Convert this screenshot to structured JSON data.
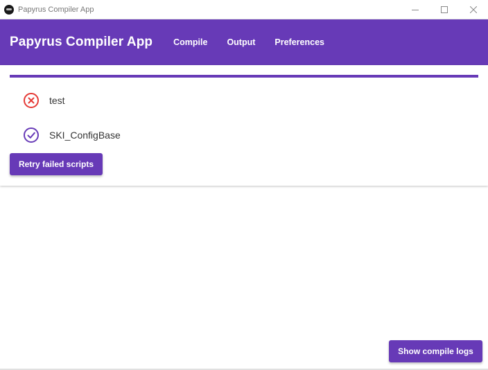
{
  "window": {
    "title": "Papyrus Compiler App",
    "controls": [
      "minimize-icon",
      "maximize-icon",
      "close-icon"
    ]
  },
  "appbar": {
    "title": "Papyrus Compiler App",
    "nav": [
      {
        "label": "Compile"
      },
      {
        "label": "Output"
      },
      {
        "label": "Preferences"
      }
    ]
  },
  "progress": {
    "value": 1.0
  },
  "scripts": [
    {
      "name": "test",
      "status": "failed",
      "icon": "error-circle-icon"
    },
    {
      "name": "SKI_ConfigBase",
      "status": "success",
      "icon": "check-circle-icon"
    }
  ],
  "actions": {
    "retry_label": "Retry failed scripts",
    "logs_label": "Show compile logs"
  },
  "colors": {
    "primary": "#673ab7",
    "error": "#e53935",
    "success": "#673ab7"
  }
}
